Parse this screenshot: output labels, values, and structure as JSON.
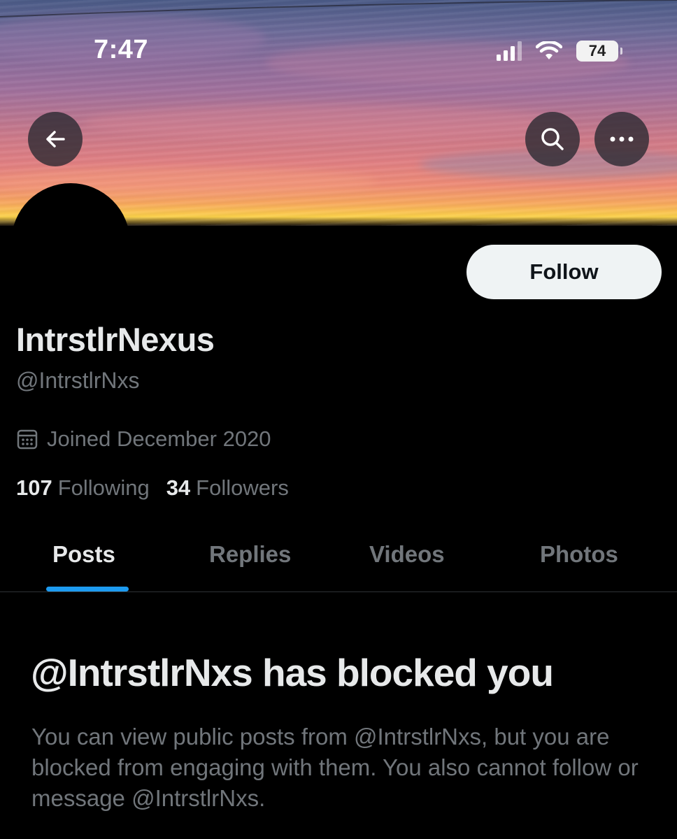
{
  "status_bar": {
    "time": "7:47",
    "battery": "74",
    "icons": [
      "cellular-signal-icon",
      "wifi-icon",
      "battery-icon"
    ]
  },
  "header": {
    "back_icon": "arrow-left-icon",
    "search_icon": "search-icon",
    "more_icon": "more-horizontal-icon"
  },
  "profile": {
    "follow_label": "Follow",
    "display_name": "IntrstlrNexus",
    "handle": "@IntrstlrNxs",
    "joined": "Joined December 2020",
    "following_count": "107",
    "following_label": "Following",
    "followers_count": "34",
    "followers_label": "Followers"
  },
  "tabs": [
    {
      "label": "Posts",
      "active": true
    },
    {
      "label": "Replies",
      "active": false
    },
    {
      "label": "Videos",
      "active": false
    },
    {
      "label": "Photos",
      "active": false
    }
  ],
  "blocked": {
    "title": "@IntrstlrNxs has blocked you",
    "body": "You can view public posts from @IntrstlrNxs, but you are blocked from engaging with them. You also cannot follow or message @IntrstlrNxs."
  },
  "colors": {
    "background": "#000000",
    "text_primary": "#e7e9ea",
    "text_secondary": "#71767b",
    "accent": "#1d9bf0",
    "follow_button_bg": "#eff3f4"
  }
}
